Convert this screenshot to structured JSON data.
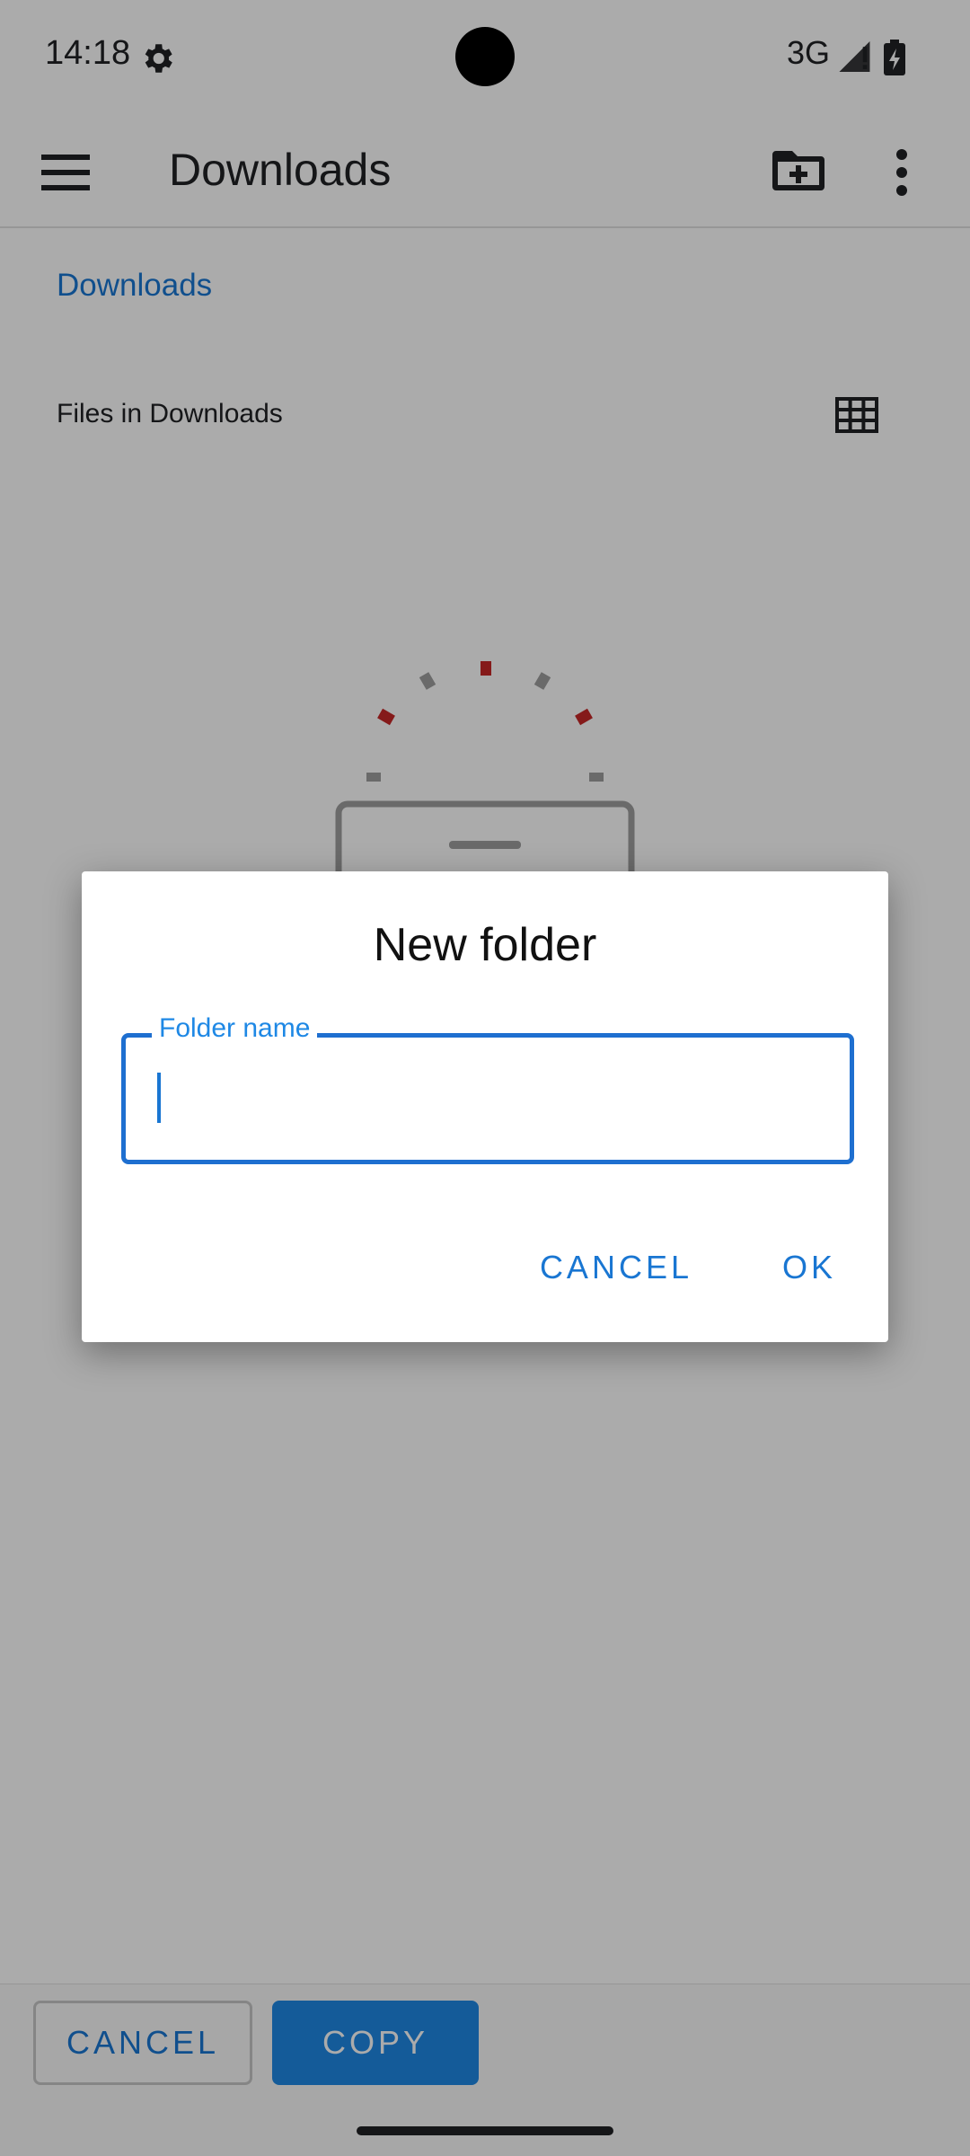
{
  "status_bar": {
    "time": "14:18",
    "network": "3G"
  },
  "app_bar": {
    "title": "Downloads"
  },
  "breadcrumb": {
    "label": "Downloads"
  },
  "files_header": {
    "label": "Files in Downloads"
  },
  "bottom_bar": {
    "cancel_label": "CANCEL",
    "copy_label": "COPY"
  },
  "dialog": {
    "title": "New folder",
    "field": {
      "label": "Folder name",
      "value": ""
    },
    "cancel_label": "CANCEL",
    "ok_label": "OK"
  },
  "colors": {
    "accent": "#1976d2",
    "primary_button": "#1e88e5",
    "illustration_red": "#c62828",
    "illustration_gray": "#9e9e9e"
  }
}
